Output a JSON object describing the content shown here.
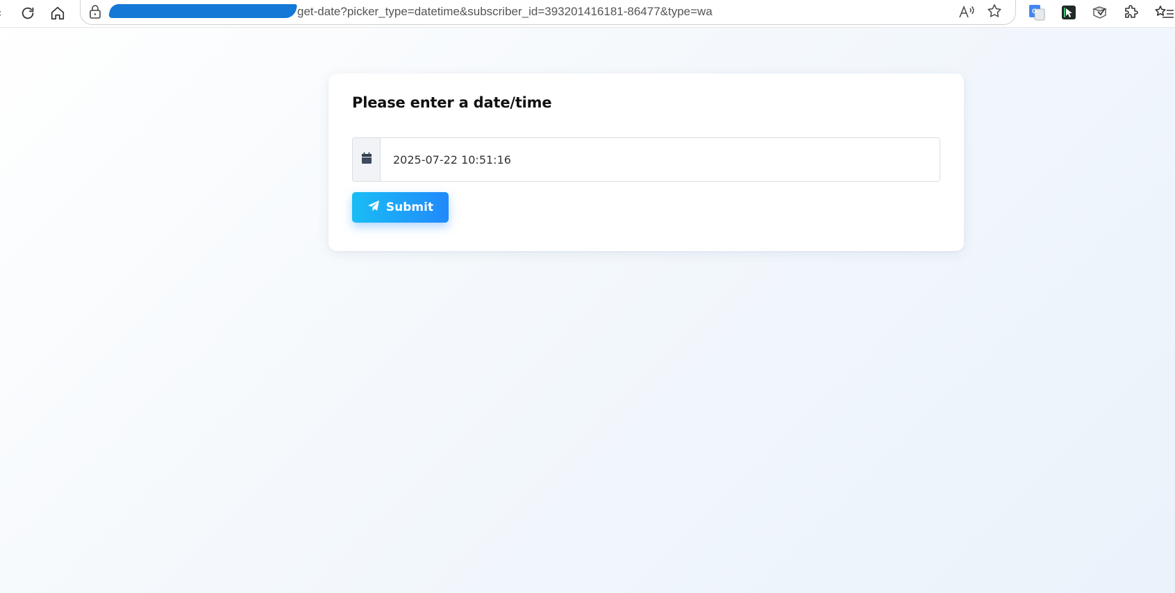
{
  "browser": {
    "url_visible": "get-date?picker_type=datetime&subscriber_id=393201416181-86477&type=wa",
    "icons": [
      "refresh-icon",
      "home-icon",
      "site-info-icon",
      "read-aloud-icon",
      "favorite-star-icon",
      "translate-extension-icon",
      "cursor-extension-icon",
      "extension-icon-3",
      "extensions-puzzle-icon",
      "favorites-list-icon"
    ],
    "redaction_color": "#1478d6"
  },
  "form": {
    "title": "Please enter a date/time",
    "datetime_value": "2025-07-22 10:51:16",
    "input_icon": "calendar-icon",
    "submit_label": "Submit",
    "submit_icon": "paper-plane-icon"
  },
  "colors": {
    "button_gradient_start": "#19bdf5",
    "button_gradient_end": "#2189fb",
    "addon_background": "#f1f3f6"
  }
}
